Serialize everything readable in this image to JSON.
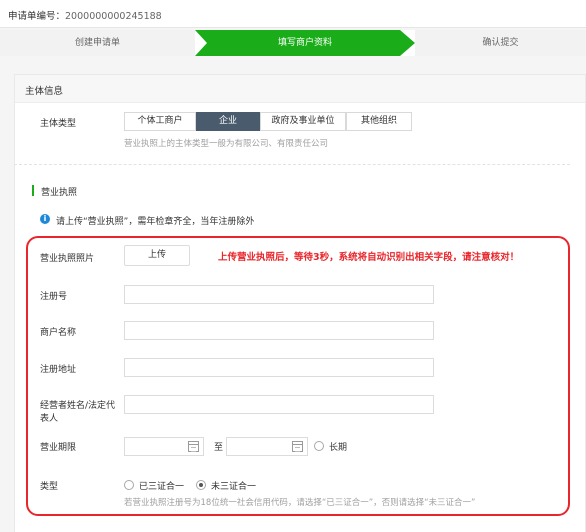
{
  "header": {
    "application_no_label": "申请单编号：",
    "application_no": "2000000000245188"
  },
  "steps": [
    {
      "label": "创建申请单",
      "state": "done"
    },
    {
      "label": "填写商户资料",
      "state": "active"
    },
    {
      "label": "确认提交",
      "state": "todo"
    }
  ],
  "colors": {
    "active_step": "#1aad19",
    "accent_red": "#e8262b",
    "segment_active": "#4b5b6e",
    "info_blue": "#1e88d9"
  },
  "subject": {
    "section_title": "主体信息",
    "type_label": "主体类型",
    "type_options": [
      "个体工商户",
      "企业",
      "政府及事业单位",
      "其他组织"
    ],
    "type_selected": "企业",
    "type_hint": "营业执照上的主体类型一般为有限公司、有限责任公司"
  },
  "license": {
    "title": "营业执照",
    "notice": "请上传“营业执照”，需年检章齐全，当年注册除外",
    "photo_label": "营业执照照片",
    "upload_label": "上传",
    "auto_note": "上传营业执照后，等待3秒，系统将自动识别出相关字段，请注意核对！",
    "reg_no_label": "注册号",
    "reg_no_value": "",
    "merchant_name_label": "商户名称",
    "merchant_name_value": "",
    "reg_address_label": "注册地址",
    "reg_address_value": "",
    "operator_label_line1": "经营者姓名/法定代",
    "operator_label_line2": "表人",
    "operator_value": "",
    "period_label": "营业期限",
    "period_to": "至",
    "period_long_term": "长期",
    "period_long_term_checked": false,
    "kind_label": "类型",
    "kind_options": [
      "已三证合一",
      "未三证合一"
    ],
    "kind_selected": "未三证合一",
    "kind_hint": "若营业执照注册号为18位统一社会信用代码，请选择“已三证合一”，否则请选择“未三证合一”"
  }
}
